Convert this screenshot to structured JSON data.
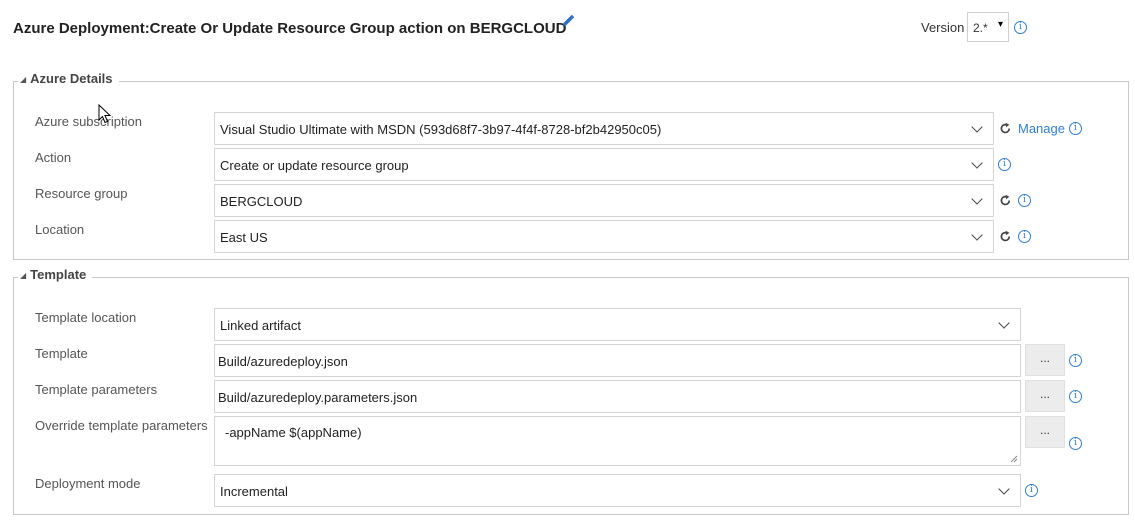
{
  "header": {
    "title": "Azure Deployment:Create Or Update Resource Group action on BERGCLOUD",
    "version_label": "Version",
    "version_value": "2.*",
    "version_caret": "▾"
  },
  "azure_details": {
    "legend": "Azure Details",
    "subscription_label": "Azure subscription",
    "subscription_value": "Visual Studio Ultimate with MSDN (593d68f7-3b97-4f4f-8728-bf2b42950c05)",
    "manage_link": "Manage",
    "action_label": "Action",
    "action_value": "Create or update resource group",
    "resource_group_label": "Resource group",
    "resource_group_value": "BERGCLOUD",
    "location_label": "Location",
    "location_value": "East US"
  },
  "template": {
    "legend": "Template",
    "template_location_label": "Template location",
    "template_location_value": "Linked artifact",
    "template_label": "Template",
    "template_value": "Build/azuredeploy.json",
    "template_parameters_label": "Template parameters",
    "template_parameters_value": "Build/azuredeploy.parameters.json",
    "override_label": "Override template parameters",
    "override_value": "-appName $(appName)",
    "deployment_mode_label": "Deployment mode",
    "deployment_mode_value": "Incremental",
    "browse_label": "..."
  },
  "icons": {
    "info_glyph": "i",
    "legend_triangle": "◢"
  },
  "colors": {
    "link": "#2f7ed8",
    "border": "#c8c8c8",
    "button_bg": "#ececec"
  }
}
